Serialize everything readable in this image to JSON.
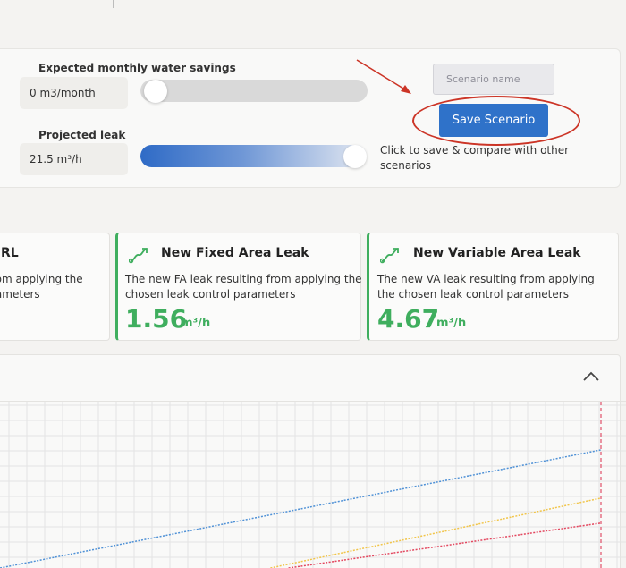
{
  "controls": {
    "savings_label": "Expected monthly water savings",
    "savings_value": "0 m3/month",
    "savings_level": 0,
    "leak_label": "Projected leak",
    "leak_value": "21.5 m³/h",
    "leak_level": 1.0
  },
  "scenario": {
    "name_placeholder": "Scenario name",
    "save_label": "Save Scenario",
    "helper_text": "Click to save & compare with other scenarios"
  },
  "cards": [
    {
      "title": "RL",
      "desc": "rom applying the rameters"
    },
    {
      "title": "New Fixed Area Leak",
      "desc": "The new FA leak resulting from applying the chosen leak control parameters",
      "value": "1.56",
      "unit": "m³/h"
    },
    {
      "title": "New Variable Area Leak",
      "desc": "The new VA leak resulting from applying the chosen leak control parameters",
      "value": "4.67",
      "unit": "m³/h"
    }
  ],
  "colors": {
    "accent_green": "#3fae5e",
    "button_blue": "#2f72c9",
    "highlight_red": "#cc3527",
    "series_blue": "#4f91d6",
    "series_yellow": "#f1c54a",
    "series_red": "#e3475f"
  },
  "chart_data": {
    "type": "line",
    "series": [
      {
        "x": [
          0,
          1
        ],
        "values": [
          0,
          0.71
        ]
      },
      {
        "x": [
          0.45,
          1
        ],
        "values": [
          0,
          0.42
        ]
      },
      {
        "x": [
          0.48,
          1
        ],
        "values": [
          0,
          0.27
        ]
      }
    ],
    "xlim": [
      0,
      1
    ],
    "ylim": [
      0,
      1
    ],
    "grid": true,
    "reference_line": 1
  }
}
